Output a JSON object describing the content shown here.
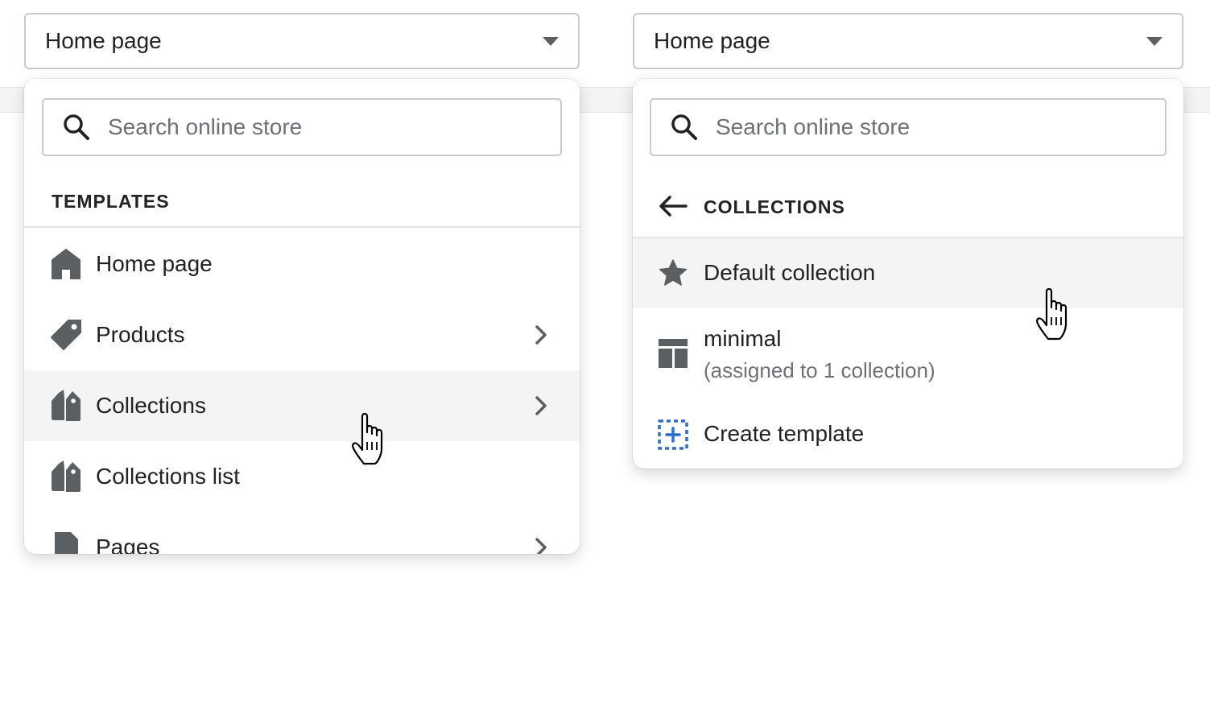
{
  "left_dropdown": {
    "selected": "Home page",
    "search_placeholder": "Search online store",
    "section_title": "TEMPLATES",
    "items": [
      {
        "label": "Home page",
        "icon": "home-icon"
      },
      {
        "label": "Products",
        "icon": "tag-icon"
      },
      {
        "label": "Collections",
        "icon": "collections-icon"
      },
      {
        "label": "Collections list",
        "icon": "collections-icon"
      },
      {
        "label": "Pages",
        "icon": "page-icon"
      }
    ]
  },
  "right_dropdown": {
    "selected": "Home page",
    "search_placeholder": "Search online store",
    "section_title": "COLLECTIONS",
    "items": [
      {
        "label": "Default collection",
        "icon": "star-icon"
      },
      {
        "label": "minimal",
        "sublabel": "(assigned to 1 collection)",
        "icon": "layout-icon"
      }
    ],
    "create_label": "Create template"
  },
  "colors": {
    "icon": "#5c5f62",
    "link": "#2c6ecb",
    "hover_bg": "#f4f4f4"
  }
}
